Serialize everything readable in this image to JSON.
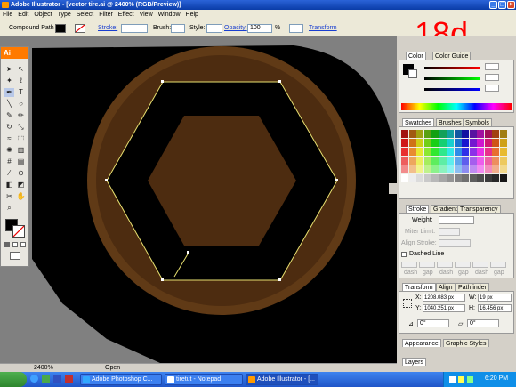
{
  "window": {
    "title": "Adobe Illustrator - [vector tire.ai @ 2400% (RGB/Preview)]"
  },
  "menu": [
    "File",
    "Edit",
    "Object",
    "Type",
    "Select",
    "Filter",
    "Effect",
    "View",
    "Window",
    "Help"
  ],
  "control": {
    "selection_type": "Compound Path",
    "stroke_label": "Stroke:",
    "brush_label": "Brush:",
    "style_label": "Style:",
    "opacity_label": "Opacity:",
    "opacity_value": "100",
    "opacity_unit": "%",
    "transform_label": "Transform"
  },
  "toolbox": {
    "logo": "Ai"
  },
  "overlay": {
    "step": "18d"
  },
  "colors": {
    "dark_brown": "#4d2c10",
    "light_brown": "#603a16",
    "path": "#e8e070",
    "accent": "#ff0000"
  },
  "status": {
    "zoom": "2400%",
    "mode": "Open"
  },
  "panels": {
    "color": {
      "tabs": [
        "Color",
        "Color Guide"
      ]
    },
    "swatches": {
      "tabs": [
        "Swatches",
        "Brushes",
        "Symbols"
      ]
    },
    "stroke": {
      "tabs": [
        "Stroke",
        "Gradient",
        "Transparency"
      ],
      "weight_label": "Weight:",
      "miter_label": "Miter Limit:",
      "align_label": "Align Stroke:",
      "dashed": "Dashed Line",
      "dash_labels": [
        "dash",
        "gap",
        "dash",
        "gap",
        "dash",
        "gap"
      ]
    },
    "transform": {
      "tabs": [
        "Transform",
        "Align",
        "Pathfinder"
      ],
      "x_label": "X:",
      "x_value": "1208.083 px",
      "y_label": "Y:",
      "y_value": "1040.251 px",
      "w_label": "W:",
      "w_value": "19 px",
      "h_label": "H:",
      "h_value": "16.456 px",
      "rot": "0°",
      "shear": "0°"
    },
    "appearance": {
      "tabs": [
        "Appearance",
        "Graphic Styles"
      ]
    },
    "layers": {
      "tabs": [
        "Layers"
      ]
    }
  },
  "taskbar": {
    "tasks": [
      "Adobe Photoshop C...",
      "tiretut - Notepad",
      "Adobe Illustrator - [..."
    ],
    "clock": "6:20 PM"
  }
}
